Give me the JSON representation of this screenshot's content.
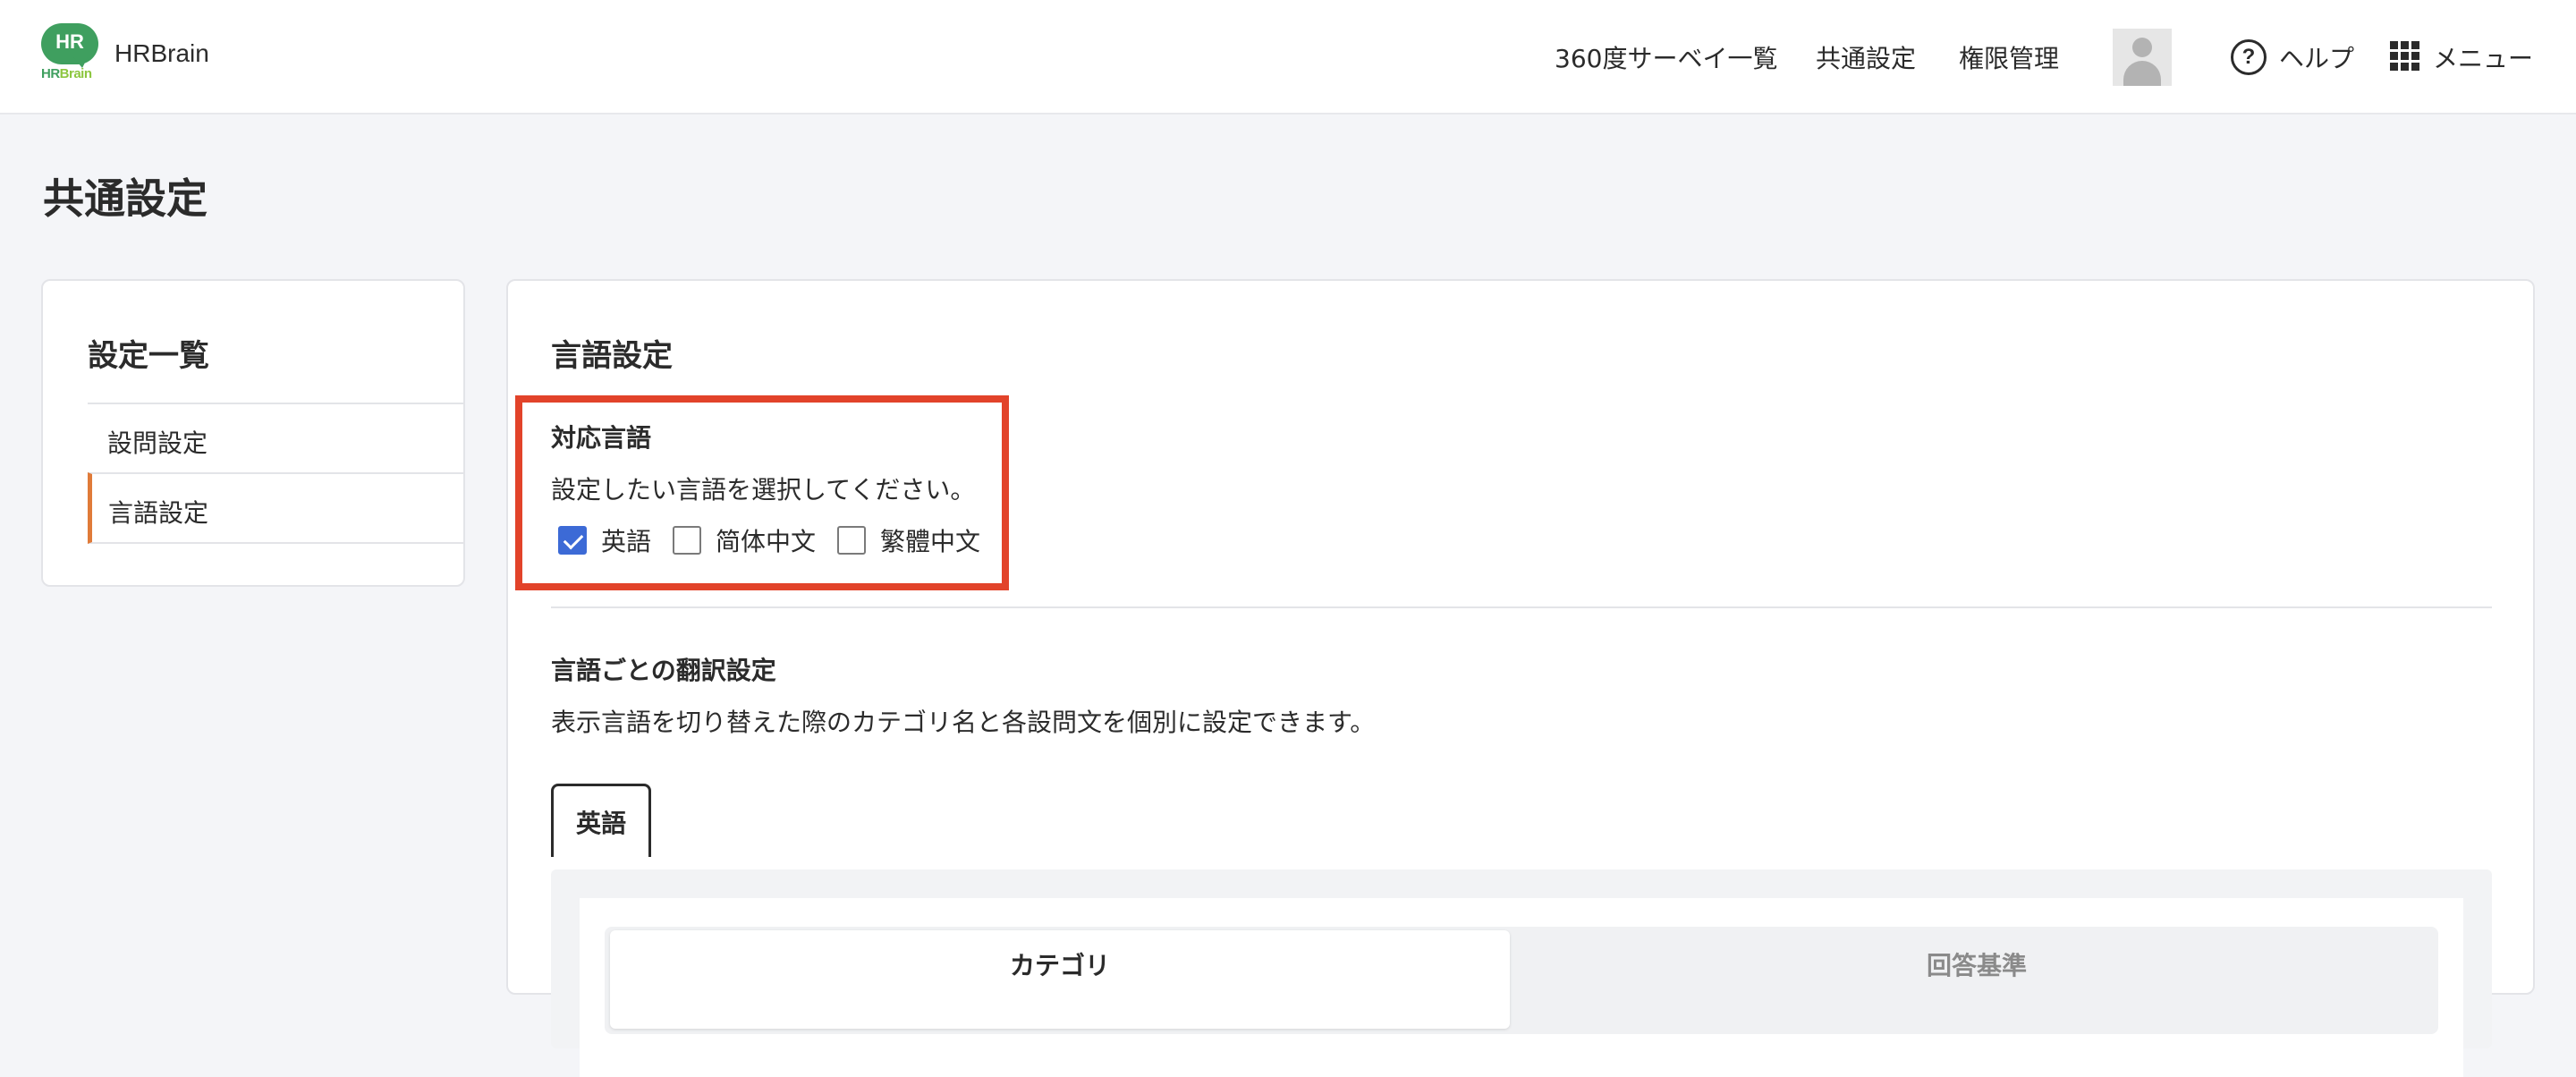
{
  "header": {
    "logo_text": "HR",
    "logo_sub_1": "HR",
    "logo_sub_2": "Brain",
    "brand": "HRBrain",
    "nav": [
      "360度サーベイ一覧",
      "共通設定",
      "権限管理"
    ],
    "help_label": "ヘルプ",
    "menu_label": "メニュー",
    "help_glyph": "?"
  },
  "page": {
    "title": "共通設定"
  },
  "sidebar": {
    "title": "設定一覧",
    "items": [
      {
        "label": "設問設定",
        "active": false
      },
      {
        "label": "言語設定",
        "active": true
      }
    ]
  },
  "main": {
    "title": "言語設定",
    "supported": {
      "title": "対応言語",
      "description": "設定したい言語を選択してください。",
      "options": [
        {
          "label": "英語",
          "checked": true
        },
        {
          "label": "简体中文",
          "checked": false
        },
        {
          "label": "繁體中文",
          "checked": false
        }
      ]
    },
    "translation": {
      "title": "言語ごとの翻訳設定",
      "description": "表示言語を切り替えた際のカテゴリ名と各設問文を個別に設定できます。",
      "tab": "英語",
      "segments": [
        {
          "label": "カテゴリ",
          "active": true
        },
        {
          "label": "回答基準",
          "active": false
        }
      ]
    }
  },
  "colors": {
    "accent": "#3c6ad6",
    "highlight": "#e2432a",
    "active_bar": "#e07b39",
    "logo_green": "#3f9f5f"
  }
}
